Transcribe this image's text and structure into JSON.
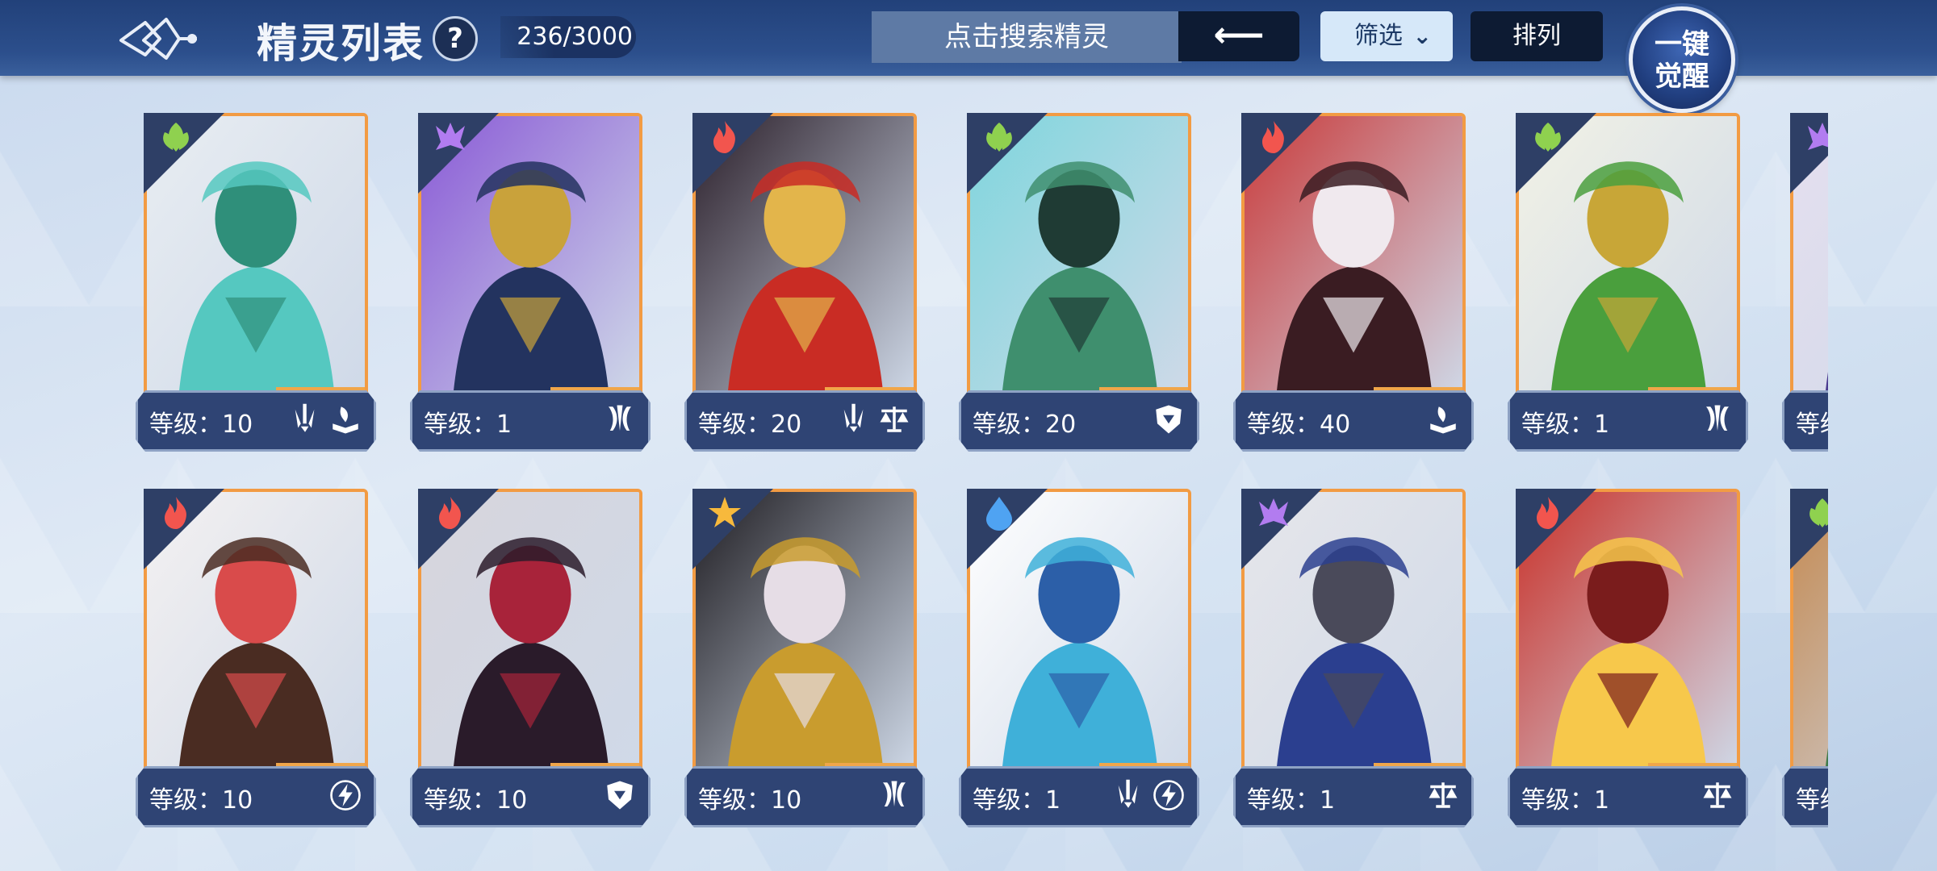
{
  "header": {
    "title": "精灵列表",
    "help_label": "?",
    "count": "236/3000",
    "search_placeholder": "点击搜索精灵",
    "back_label": "⟵",
    "filter_label": "筛选",
    "sort_label": "排列",
    "awaken_line1": "一键",
    "awaken_line2": "觉醒"
  },
  "colors": {
    "grass": "#8fd14f",
    "psychic": "#b27cf0",
    "fire": "#f2554e",
    "light": "#f7b93c",
    "water": "#4fa3f2",
    "card_border": "#f29b43"
  },
  "spirits": [
    {
      "element": "grass",
      "level": "等级：10",
      "attrs": [
        "blade-icon",
        "book-icon"
      ],
      "art": [
        "#55c8c0",
        "#e8edf2",
        "#2f8f7a"
      ]
    },
    {
      "element": "psychic",
      "level": "等级：1",
      "attrs": [
        "claw-icon"
      ],
      "art": [
        "#23335f",
        "#8a5ad6",
        "#c9a23b"
      ]
    },
    {
      "element": "fire",
      "level": "等级：20",
      "attrs": [
        "blade-icon",
        "scale-icon"
      ],
      "art": [
        "#c92c24",
        "#2b1f2a",
        "#e3b54b"
      ]
    },
    {
      "element": "grass",
      "level": "等级：20",
      "attrs": [
        "shield-icon"
      ],
      "art": [
        "#3f8f6e",
        "#7fd6dd",
        "#1f3b34"
      ]
    },
    {
      "element": "fire",
      "level": "等级：40",
      "attrs": [
        "book-icon"
      ],
      "art": [
        "#3a1c22",
        "#c93b3b",
        "#f0e9ee"
      ]
    },
    {
      "element": "grass",
      "level": "等级：1",
      "attrs": [
        "claw-icon"
      ],
      "art": [
        "#4a9f3d",
        "#f2f2e6",
        "#c8a637"
      ]
    },
    {
      "element": "psychic",
      "level": "等级：",
      "attrs": [],
      "art": [
        "#4a3a8f",
        "#e5dfef",
        "#2d2a5a"
      ]
    },
    {
      "element": "fire",
      "level": "等级：10",
      "attrs": [
        "bolt-icon"
      ],
      "art": [
        "#4a2c22",
        "#f4f1f1",
        "#d94b4b"
      ]
    },
    {
      "element": "fire",
      "level": "等级：10",
      "attrs": [
        "shield-icon"
      ],
      "art": [
        "#2a1b2a",
        "#d7d5dc",
        "#a8233a"
      ]
    },
    {
      "element": "light",
      "level": "等级：10",
      "attrs": [
        "claw-icon"
      ],
      "art": [
        "#c99c2e",
        "#1f1d22",
        "#e6dde6"
      ]
    },
    {
      "element": "water",
      "level": "等级：1",
      "attrs": [
        "blade-icon",
        "bolt-icon"
      ],
      "art": [
        "#3fb0d9",
        "#ffffff",
        "#2c5fa8"
      ]
    },
    {
      "element": "psychic",
      "level": "等级：1",
      "attrs": [
        "scale-icon"
      ],
      "art": [
        "#2b3f8f",
        "#e6e6ea",
        "#4a4a5a"
      ]
    },
    {
      "element": "fire",
      "level": "等级：1",
      "attrs": [
        "scale-icon"
      ],
      "art": [
        "#f7c84b",
        "#c9322a",
        "#7a1c1c"
      ]
    },
    {
      "element": "grass",
      "level": "等级：",
      "attrs": [],
      "art": [
        "#3e7a4a",
        "#c48a52",
        "#e6eaf0"
      ]
    }
  ]
}
